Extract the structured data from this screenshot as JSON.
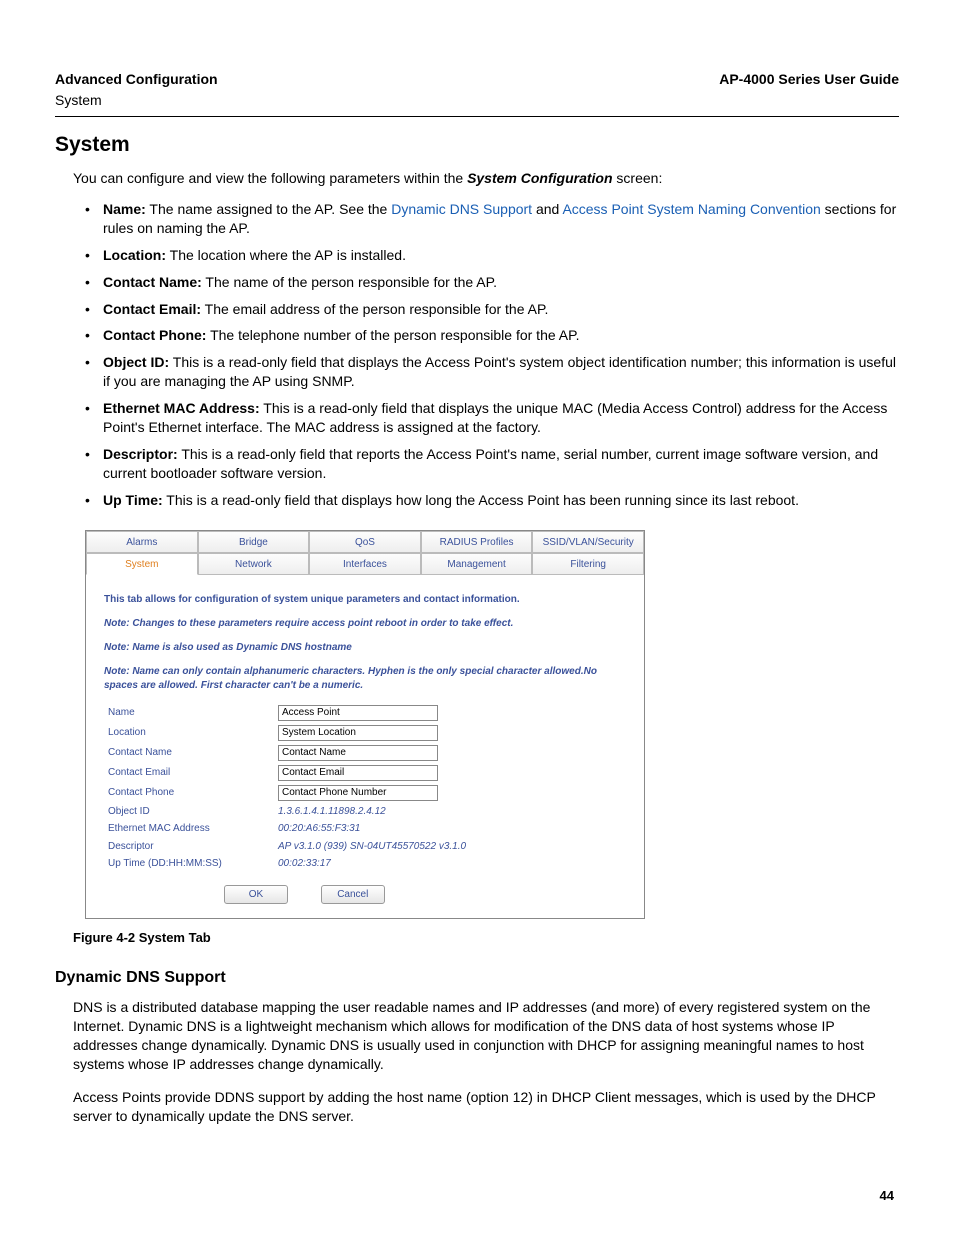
{
  "header": {
    "left": "Advanced Configuration",
    "right": "AP-4000 Series User Guide",
    "sub": "System"
  },
  "section_title": "System",
  "intro_pre": "You can configure and view the following parameters within the ",
  "intro_em": "System Configuration",
  "intro_post": " screen:",
  "bullets": [
    {
      "label": "Name:",
      "pre": " The name assigned to the AP. See the ",
      "link1": "Dynamic DNS Support",
      "mid": " and ",
      "link2": "Access Point System Naming Convention",
      "post": " sections for rules on naming the AP."
    },
    {
      "label": "Location:",
      "text": " The location where the AP is installed."
    },
    {
      "label": "Contact Name:",
      "text": " The name of the person responsible for the AP."
    },
    {
      "label": "Contact Email:",
      "text": " The email address of the person responsible for the AP."
    },
    {
      "label": "Contact Phone:",
      "text": " The telephone number of the person responsible for the AP."
    },
    {
      "label": "Object ID:",
      "text": " This is a read-only field that displays the Access Point's system object identification number; this information is useful if you are managing the AP using SNMP."
    },
    {
      "label": "Ethernet MAC Address:",
      "text": " This is a read-only field that displays the unique MAC (Media Access Control) address for the Access Point's Ethernet interface. The MAC address is assigned at the factory."
    },
    {
      "label": "Descriptor:",
      "text": " This is a read-only field that reports the Access Point's name, serial number, current image software version, and current bootloader software version."
    },
    {
      "label": "Up Time:",
      "text": " This is a read-only field that displays how long the Access Point has been running since its last reboot."
    }
  ],
  "screenshot": {
    "tabs_row1": [
      "Alarms",
      "Bridge",
      "QoS",
      "RADIUS Profiles",
      "SSID/VLAN/Security"
    ],
    "tabs_row2": [
      "System",
      "Network",
      "Interfaces",
      "Management",
      "Filtering"
    ],
    "active_tab": "System",
    "notes": [
      "This tab allows for configuration of system unique parameters and contact information.",
      "Note: Changes to these parameters require access point reboot in order to take effect.",
      "Note: Name is also used as Dynamic DNS hostname",
      "Note: Name can only contain alphanumeric characters. Hyphen is the only special character allowed.No spaces are allowed. First character can't be a numeric."
    ],
    "fields": {
      "name_label": "Name",
      "name_value": "Access Point",
      "location_label": "Location",
      "location_value": "System Location",
      "cname_label": "Contact Name",
      "cname_value": "Contact Name",
      "cemail_label": "Contact Email",
      "cemail_value": "Contact Email",
      "cphone_label": "Contact Phone",
      "cphone_value": "Contact Phone Number",
      "objid_label": "Object ID",
      "objid_value": "1.3.6.1.4.1.11898.2.4.12",
      "mac_label": "Ethernet MAC Address",
      "mac_value": "00:20:A6:55:F3:31",
      "desc_label": "Descriptor",
      "desc_value": "AP v3.1.0 (939) SN-04UT45570522 v3.1.0",
      "uptime_label": "Up Time (DD:HH:MM:SS)",
      "uptime_value": "00:02:33:17"
    },
    "buttons": {
      "ok": "OK",
      "cancel": "Cancel"
    }
  },
  "figure_caption": "Figure 4-2 System Tab",
  "subsection_title": "Dynamic DNS Support",
  "para1": "DNS is a distributed database mapping the user readable names and IP addresses (and more) of every registered system on the Internet. Dynamic DNS is a lightweight mechanism which allows for modification of the DNS data of host systems whose IP addresses change dynamically. Dynamic DNS is usually used in conjunction with DHCP for assigning meaningful names to host systems whose IP addresses change dynamically.",
  "para2": "Access Points provide DDNS support by adding the host name (option 12) in DHCP Client messages, which is used by the DHCP server to dynamically update the DNS server.",
  "page_number": "44"
}
